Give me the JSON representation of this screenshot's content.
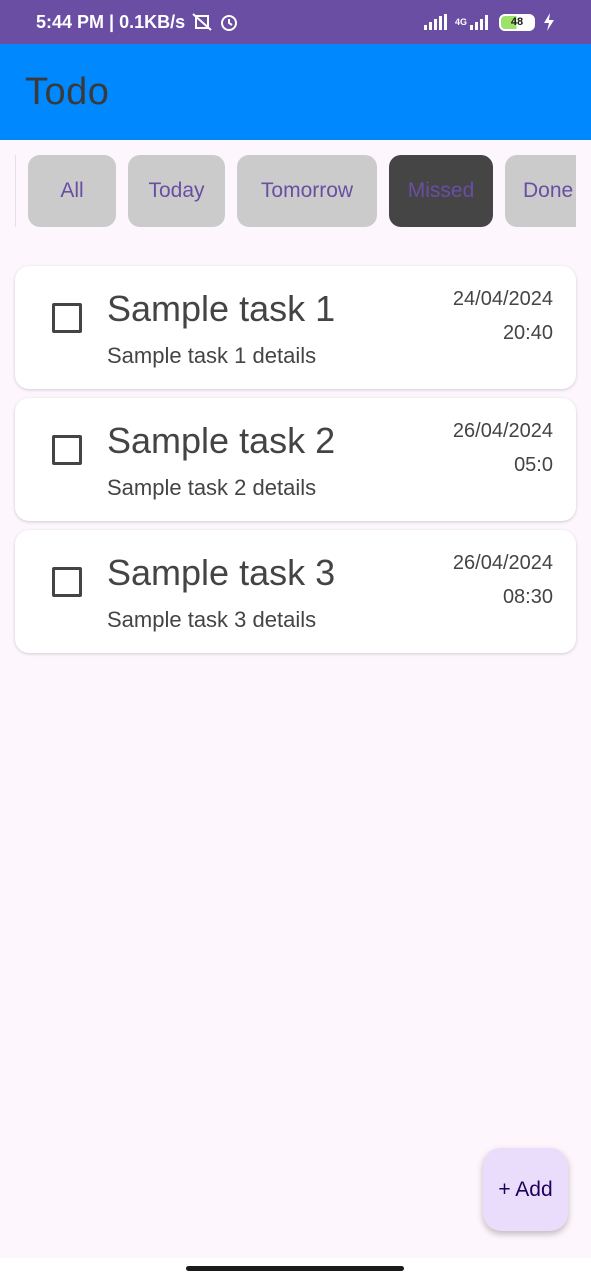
{
  "status_bar": {
    "time_speed": "5:44 PM | 0.1KB/s",
    "icons": [
      "mute-vibrate-icon",
      "alarm-icon",
      "signal-icon",
      "4g-signal-icon",
      "charging-icon"
    ],
    "network_label": "4G",
    "battery": "48"
  },
  "app_bar": {
    "title": "Todo"
  },
  "filters": {
    "chips": [
      {
        "label": "All",
        "active": false
      },
      {
        "label": "Today",
        "active": false
      },
      {
        "label": "Tomorrow",
        "active": false
      },
      {
        "label": "Missed",
        "active": true
      },
      {
        "label": "Done",
        "active": false
      }
    ]
  },
  "tasks": [
    {
      "title": "Sample task 1",
      "details": "Sample task 1 details",
      "date": "24/04/2024",
      "time": "20:40",
      "checked": false
    },
    {
      "title": "Sample task 2",
      "details": "Sample task 2 details",
      "date": "26/04/2024",
      "time": "05:0",
      "checked": false
    },
    {
      "title": "Sample task 3",
      "details": "Sample task 3 details",
      "date": "26/04/2024",
      "time": "08:30",
      "checked": false
    }
  ],
  "fab": {
    "label": "+ Add"
  },
  "colors": {
    "status_bar": "#6a4ea3",
    "app_bar": "#0088ff",
    "chip_bg": "#cbcbcb",
    "chip_active_bg": "#454545",
    "chip_text": "#6a4ea3",
    "fab_bg": "#eaddfb",
    "page_bg": "#fdf7fd"
  }
}
